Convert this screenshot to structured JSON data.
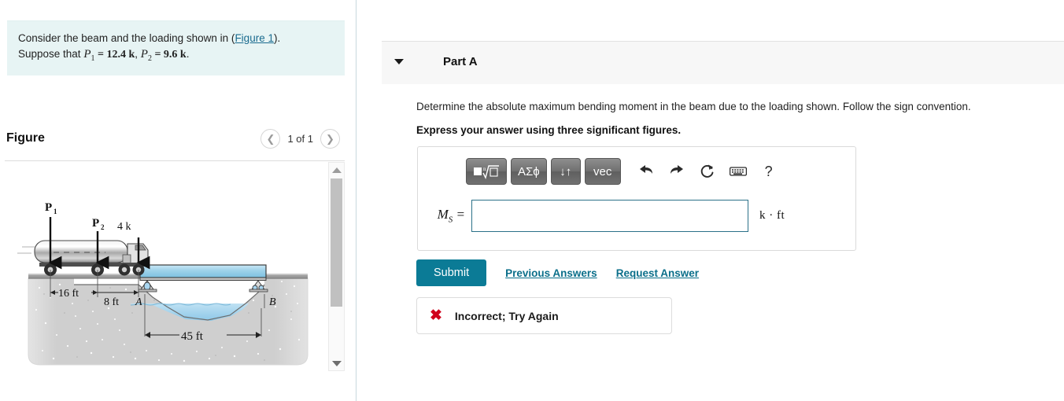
{
  "left_panel": {
    "info": {
      "line1_pre": "Consider the beam and the loading shown in (",
      "figure_link": "Figure 1",
      "line1_post": ").",
      "line2_pre": "Suppose that ",
      "p1_symbol": "P",
      "p1_sub": "1",
      "p1_value": " = 12.4 k",
      "sep": ", ",
      "p2_symbol": "P",
      "p2_sub": "2",
      "p2_value": " = 9.6 k",
      "line2_post": "."
    },
    "figure_header": {
      "title": "Figure",
      "prev_icon": "chevron-left-icon",
      "pager_label": "1 of 1",
      "next_icon": "chevron-right-icon"
    },
    "figure": {
      "load_p1": "P",
      "load_p1_sub": "1",
      "load_p2": "P",
      "load_p2_sub": "2",
      "load_3": "4 k",
      "dim_16": "16 ft",
      "dim_8": "8 ft",
      "dim_45": "45 ft",
      "support_a": "A",
      "support_b": "B",
      "colors": {
        "beam": "#9ed2ea",
        "beam_edge": "#4a4a4a",
        "water": "#a8d5ef",
        "soil": "#cfcfcf",
        "road": "#8a8a8a"
      }
    },
    "scrollbar": {
      "up_icon": "triangle-up-icon",
      "down_icon": "triangle-down-icon"
    }
  },
  "right_panel": {
    "part": {
      "caret_icon": "caret-down-icon",
      "title": "Part A"
    },
    "question": "Determine the absolute maximum bending moment in the beam due to the loading shown. Follow the sign convention.",
    "express": "Express your answer using three significant figures.",
    "toolbar": {
      "buttons": [
        {
          "name": "template-radical-button",
          "label": "█√□"
        },
        {
          "name": "greek-symbols-button",
          "label": "ΑΣϕ"
        },
        {
          "name": "arrows-button",
          "label": "↓↑"
        },
        {
          "name": "vector-button",
          "label": "vec"
        }
      ],
      "undo_icon": "undo-arrow-icon",
      "redo_icon": "redo-arrow-icon",
      "reset_icon": "reset-circular-arrow-icon",
      "keyboard_icon": "keyboard-icon",
      "help_icon": "question-mark-icon",
      "help_label": "?"
    },
    "answer": {
      "label_symbol": "M",
      "label_sub": "S",
      "label_eq": " =",
      "value": "",
      "placeholder": "",
      "units": "k · ft"
    },
    "actions": {
      "submit_label": "Submit",
      "previous_answers_label": "Previous Answers",
      "request_answer_label": "Request Answer"
    },
    "feedback": {
      "icon": "x-mark-icon",
      "mark": "✖",
      "text": "Incorrect; Try Again"
    }
  }
}
